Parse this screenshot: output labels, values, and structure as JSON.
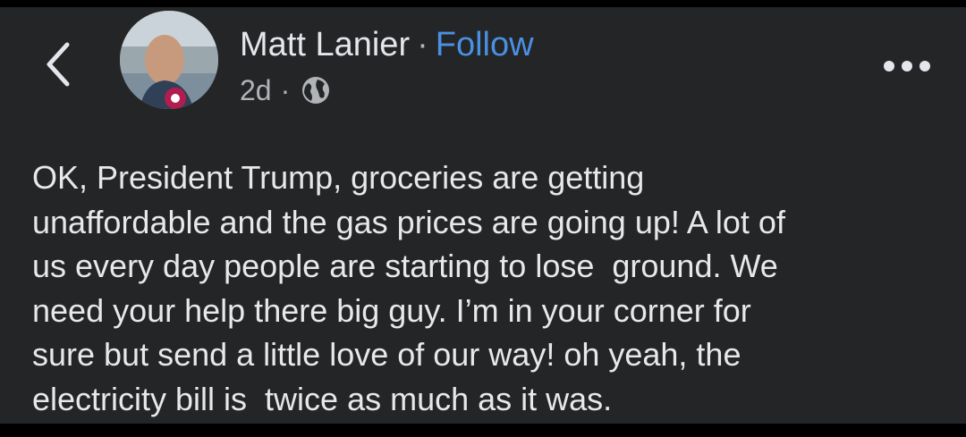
{
  "header": {
    "back_icon": "chevron-left-icon",
    "author_name": "Matt Lanier",
    "separator": "·",
    "follow_label": "Follow",
    "timestamp": "2d",
    "meta_separator": "·",
    "privacy_icon": "globe-icon",
    "more_icon": "more-horizontal-icon"
  },
  "post": {
    "text": "OK, President Trump, groceries are getting\nunaffordable and the gas prices are going up! A lot of\nus every day people are starting to lose  ground. We\nneed your help there big guy. I’m in your corner for\nsure but send a little love of our way! oh yeah, the\nelectricity bill is  twice as much as it was."
  },
  "colors": {
    "background": "#242526",
    "text": "#e4e6eb",
    "secondary_text": "#b0b3b8",
    "link": "#4a90e2"
  }
}
